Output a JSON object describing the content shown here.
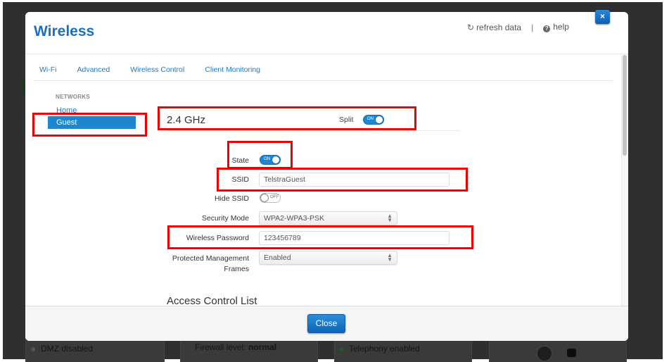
{
  "modal": {
    "title": "Wireless",
    "refresh_label": "refresh data",
    "separator": "|",
    "help_label": "help",
    "close_x_label": "×",
    "close_button_label": "Close"
  },
  "tabs": [
    {
      "label": "Wi-Fi"
    },
    {
      "label": "Advanced"
    },
    {
      "label": "Wireless Control"
    },
    {
      "label": "Client Monitoring"
    }
  ],
  "sidebar": {
    "heading": "NETWORKS",
    "items": [
      {
        "label": "Home",
        "selected": false
      },
      {
        "label": "Guest",
        "selected": true
      }
    ]
  },
  "section": {
    "title": "2.4 GHz",
    "split_label": "Split",
    "split_toggle": "ON"
  },
  "form": {
    "state_label": "State",
    "state_toggle": "ON",
    "ssid_label": "SSID",
    "ssid_value": "TelstraGuest",
    "hide_ssid_label": "Hide SSID",
    "hide_ssid_toggle": "OFF",
    "security_mode_label": "Security Mode",
    "security_mode_value": "WPA2-WPA3-PSK",
    "password_label": "Wireless Password",
    "password_value": "123456789",
    "pmf_label_line1": "Protected Management",
    "pmf_label_line2": "Frames",
    "pmf_value": "Enabled"
  },
  "acl": {
    "title": "Access Control List"
  },
  "background": {
    "dmz": "DMZ disabled",
    "firewall_prefix": "Firewall level: ",
    "firewall_value": "normal",
    "telephony": "Telephony enabled"
  },
  "colors": {
    "accent": "#1c87d0",
    "title": "#1a6fc0",
    "highlight": "#ee0000"
  }
}
